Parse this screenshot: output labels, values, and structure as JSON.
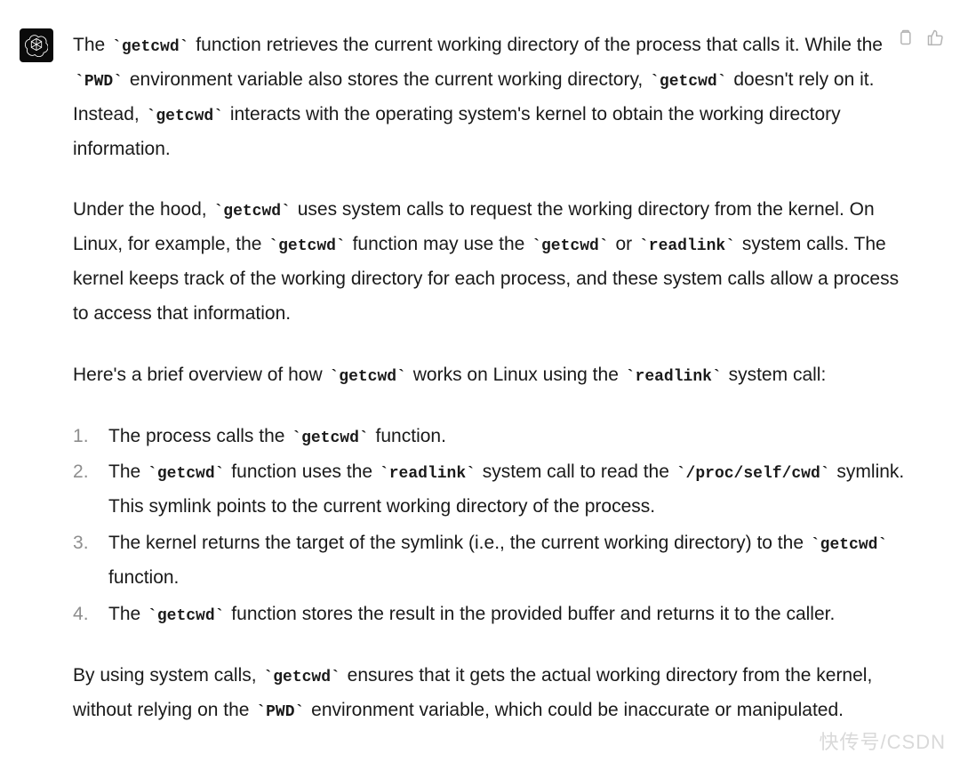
{
  "tokens": {
    "getcwd": "getcwd",
    "PWD": "PWD",
    "readlink": "readlink",
    "proc_self_cwd": "/proc/self/cwd"
  },
  "para1": {
    "t1": "The ",
    "t2": " function retrieves the current working directory of the process that calls it. While the ",
    "t3": " environment variable also stores the current working directory, ",
    "t4": " doesn't rely on it. Instead, ",
    "t5": " interacts with the operating system's kernel to obtain the working directory information."
  },
  "para2": {
    "t1": "Under the hood, ",
    "t2": " uses system calls to request the working directory from the kernel. On Linux, for example, the ",
    "t3": " function may use the ",
    "t4": " or ",
    "t5": " system calls. The kernel keeps track of the working directory for each process, and these system calls allow a process to access that information."
  },
  "para3": {
    "t1": "Here's a brief overview of how ",
    "t2": " works on Linux using the ",
    "t3": " system call:"
  },
  "list": {
    "item1": {
      "t1": "The process calls the ",
      "t2": " function."
    },
    "item2": {
      "t1": "The ",
      "t2": " function uses the ",
      "t3": " system call to read the ",
      "t4": " symlink. This symlink points to the current working directory of the process."
    },
    "item3": {
      "t1": "The kernel returns the target of the symlink (i.e., the current working directory) to the ",
      "t2": " function."
    },
    "item4": {
      "t1": "The ",
      "t2": " function stores the result in the provided buffer and returns it to the caller."
    }
  },
  "para4": {
    "t1": "By using system calls, ",
    "t2": " ensures that it gets the actual working directory from the kernel, without relying on the ",
    "t3": " environment variable, which could be inaccurate or manipulated."
  },
  "watermark": "快传号/CSDN"
}
